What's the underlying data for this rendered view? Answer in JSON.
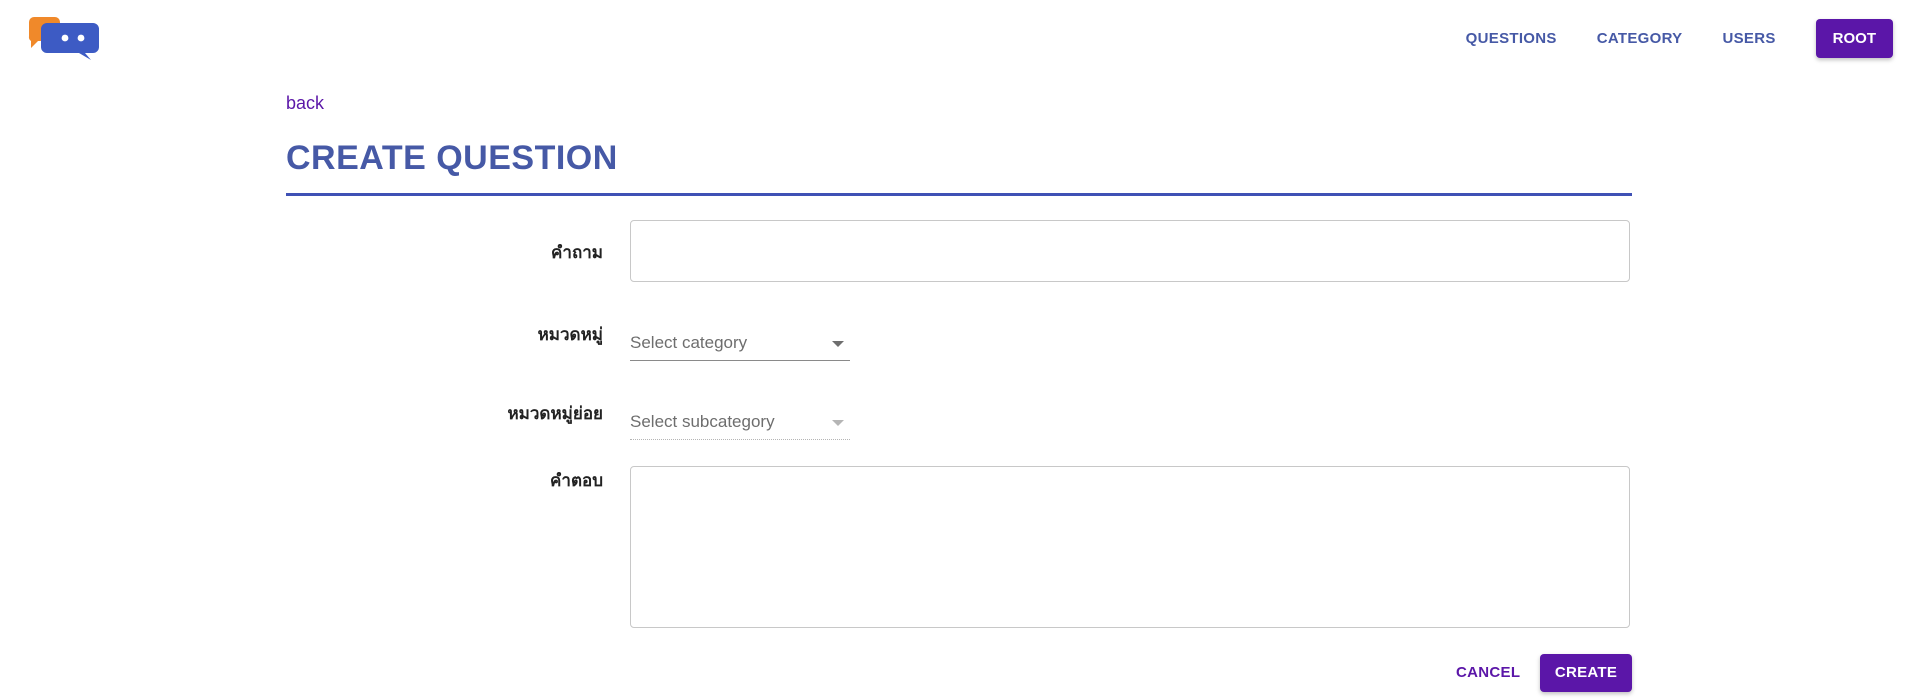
{
  "header": {
    "logo_icon": "chat-bubbles-logo",
    "nav": [
      {
        "label": "QUESTIONS"
      },
      {
        "label": "CATEGORY"
      },
      {
        "label": "USERS"
      }
    ],
    "user_button_label": "ROOT"
  },
  "main": {
    "back_label": "back",
    "title": "CREATE QUESTION",
    "form": {
      "question_label": "คำถาม",
      "question_value": "",
      "category_label": "หมวดหมู่",
      "category_placeholder": "Select category",
      "subcategory_label": "หมวดหมู่ย่อย",
      "subcategory_placeholder": "Select subcategory",
      "answer_label": "คำตอบ",
      "answer_value": ""
    },
    "actions": {
      "cancel_label": "CANCEL",
      "create_label": "CREATE"
    }
  },
  "colors": {
    "primary": "#5b16a8",
    "heading": "#4659a6",
    "rule": "#3f51b5",
    "logo_orange": "#f0892a",
    "logo_blue": "#3d5bc4"
  }
}
